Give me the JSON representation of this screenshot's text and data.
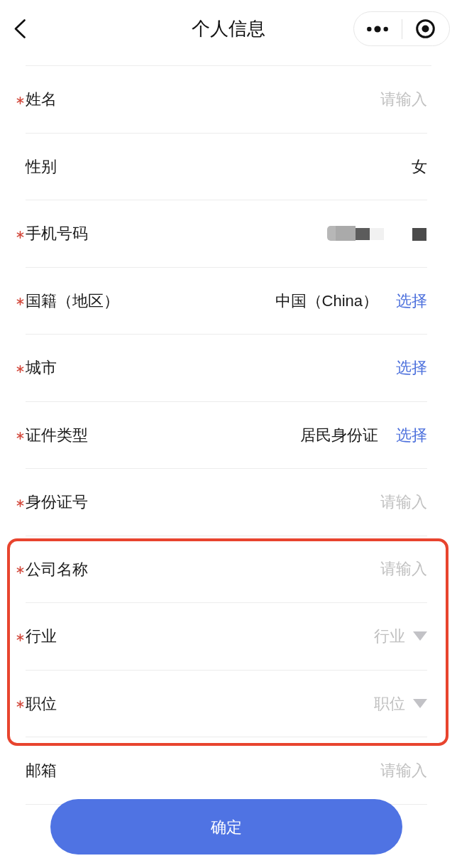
{
  "header": {
    "title": "个人信息"
  },
  "form": {
    "rows": [
      {
        "label": "姓名",
        "required": true,
        "highlighted": false,
        "kind": "input",
        "placeholder": "请输入"
      },
      {
        "label": "性别",
        "required": false,
        "highlighted": false,
        "kind": "text",
        "value": "女"
      },
      {
        "label": "手机号码",
        "required": true,
        "highlighted": false,
        "kind": "redacted"
      },
      {
        "label": "国籍（地区）",
        "required": true,
        "highlighted": false,
        "kind": "picker",
        "value": "中国（China）",
        "action": "选择"
      },
      {
        "label": "城市",
        "required": true,
        "highlighted": false,
        "kind": "picker",
        "action": "选择"
      },
      {
        "label": "证件类型",
        "required": true,
        "highlighted": false,
        "kind": "picker",
        "value": "居民身份证",
        "action": "选择"
      },
      {
        "label": "身份证号",
        "required": true,
        "highlighted": false,
        "kind": "input",
        "placeholder": "请输入"
      },
      {
        "label": "公司名称",
        "required": true,
        "highlighted": true,
        "kind": "input",
        "placeholder": "请输入"
      },
      {
        "label": "行业",
        "required": true,
        "highlighted": true,
        "kind": "dropdown",
        "placeholder": "行业"
      },
      {
        "label": "职位",
        "required": true,
        "highlighted": true,
        "kind": "dropdown",
        "placeholder": "职位"
      },
      {
        "label": "邮箱",
        "required": false,
        "highlighted": false,
        "kind": "input",
        "placeholder": "请输入"
      }
    ]
  },
  "submit_button": {
    "label": "确定"
  }
}
